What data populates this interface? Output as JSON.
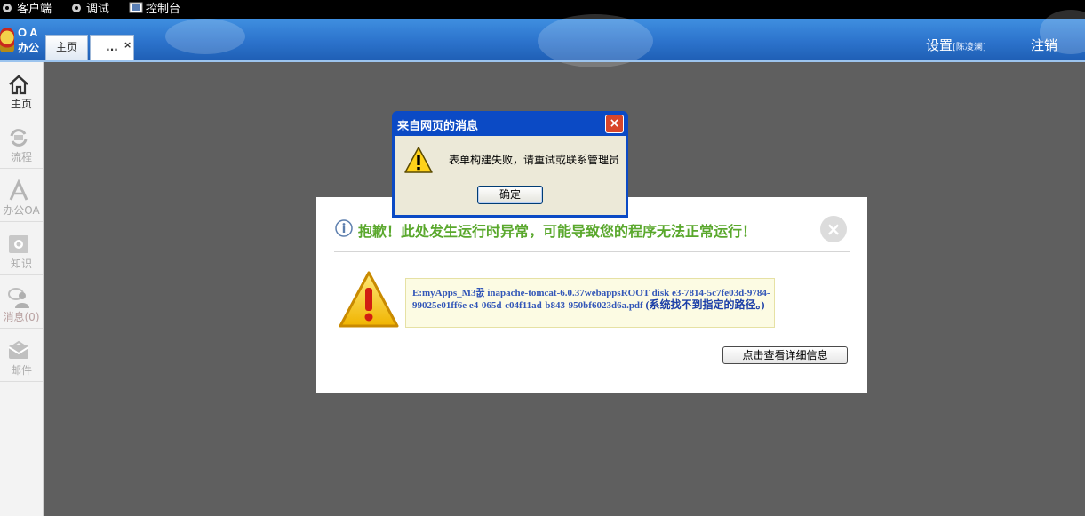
{
  "menubar": {
    "client": "客户端",
    "debug": "调试",
    "console": "控制台"
  },
  "logo": {
    "line1": "OA",
    "line2": "办公"
  },
  "tabs": [
    {
      "label": "主页"
    },
    {
      "label": "..."
    }
  ],
  "tab_close": "×",
  "header": {
    "settings": "设置",
    "user": "[陈凌澜]",
    "logout": "注销"
  },
  "sidebar": {
    "items": [
      {
        "label": "主页",
        "icon": "home-icon",
        "active": true
      },
      {
        "label": "流程",
        "icon": "workflow-icon"
      },
      {
        "label": "办公OA",
        "icon": "office-icon"
      },
      {
        "label": "知识",
        "icon": "knowledge-icon"
      },
      {
        "label": "消息(0)",
        "icon": "message-icon"
      },
      {
        "label": "邮件",
        "icon": "mail-icon"
      }
    ]
  },
  "panel": {
    "title": "抱歉！此处发生运行时异常，可能导致您的程序无法正常运行！",
    "close": "×",
    "error_path": "E:myApps_M3꿊 inapache-tomcat-6.0.37webappsROOT disk e3-7814-5c7fe03d-9784-99025e01ff6e e4-065d-c04f11ad-b843-950bf6023d6a.pdf",
    "error_reason": "(系统找不到指定的路径。)",
    "detail_button": "点击查看详细信息"
  },
  "dialog": {
    "title": "来自网页的消息",
    "close": "×",
    "message": "表单构建失败，请重试或联系管理员",
    "ok": "确定"
  },
  "colors": {
    "header_blue": "#2c73cc",
    "title_green": "#5aa82d",
    "dialog_blue": "#0b4ac5"
  }
}
